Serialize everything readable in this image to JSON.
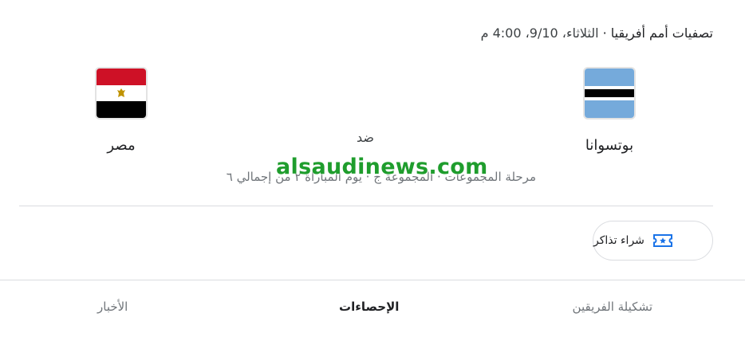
{
  "header": {
    "competition": "تصفيات أمم أفريقيا",
    "separator": "·",
    "datetime": "الثلاثاء، 9/10، 4:00 م"
  },
  "match": {
    "home_team": {
      "name": "بوتسوانا",
      "flag_icon": "botswana-flag-icon"
    },
    "away_team": {
      "name": "مصر",
      "flag_icon": "egypt-flag-icon"
    },
    "vs_label": "ضد",
    "stage": "مرحلة المجموعات · المجموعة ج · يوم المباراة ٢ من إجمالي ٦"
  },
  "watermark": "alsaudinews.com",
  "actions": {
    "tickets_label": "شراء تذاكر",
    "tickets_icon": "ticket-icon"
  },
  "tabs": [
    {
      "label": "تشكيلة الفريقين",
      "active": false
    },
    {
      "label": "الإحصاءات",
      "active": true
    },
    {
      "label": "الأخبار",
      "active": false
    }
  ],
  "colors": {
    "accent": "#1a73e8",
    "watermark": "#1f9d2d"
  }
}
